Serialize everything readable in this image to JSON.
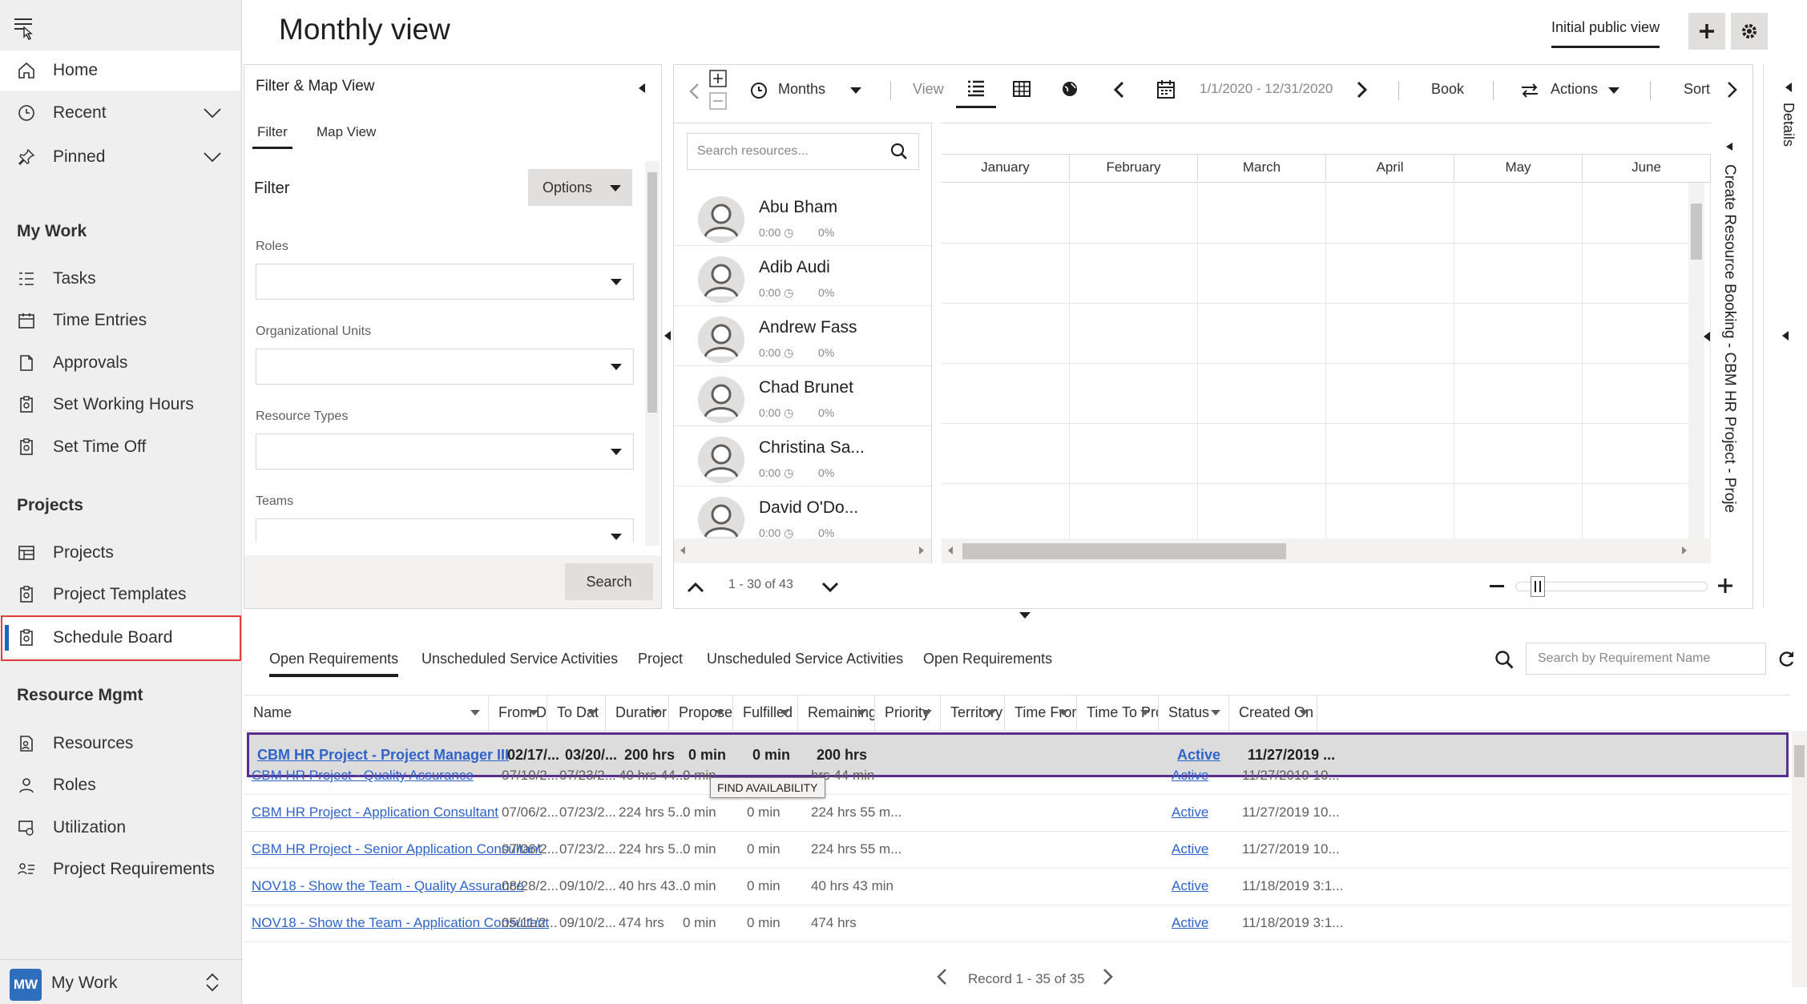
{
  "sidebar": {
    "menu_icon": "hamburger-icon",
    "home": "Home",
    "recent": "Recent",
    "pinned": "Pinned",
    "sections": [
      {
        "title": "My Work",
        "items": [
          "Tasks",
          "Time Entries",
          "Approvals",
          "Set Working Hours",
          "Set Time Off"
        ]
      },
      {
        "title": "Projects",
        "items": [
          "Projects",
          "Project Templates",
          "Schedule Board"
        ]
      },
      {
        "title": "Resource Mgmt",
        "items": [
          "Resources",
          "Roles",
          "Utilization",
          "Project Requirements"
        ]
      }
    ],
    "active_item": "Schedule Board",
    "area_badge": "MW",
    "area_label": "My Work"
  },
  "header": {
    "title": "Monthly view",
    "view_name": "Initial public view"
  },
  "filter_panel": {
    "title": "Filter & Map View",
    "tabs": [
      "Filter",
      "Map View"
    ],
    "section_title": "Filter",
    "options_label": "Options",
    "fields": [
      "Roles",
      "Organizational Units",
      "Resource Types",
      "Teams"
    ],
    "search_button": "Search"
  },
  "board": {
    "timescale": "Months",
    "view_label": "View",
    "date_range": "1/1/2020 - 12/31/2020",
    "book_label": "Book",
    "actions_label": "Actions",
    "sort_label": "Sort",
    "search_placeholder": "Search resources...",
    "months": [
      "January",
      "February",
      "March",
      "April",
      "May",
      "June"
    ],
    "resources": [
      {
        "name": "Abu Bham",
        "hours": "0:00",
        "pct": "0%"
      },
      {
        "name": "Adib Audi",
        "hours": "0:00",
        "pct": "0%"
      },
      {
        "name": "Andrew Fass",
        "hours": "0:00",
        "pct": "0%"
      },
      {
        "name": "Chad Brunet",
        "hours": "0:00",
        "pct": "0%"
      },
      {
        "name": "Christina Sa...",
        "hours": "0:00",
        "pct": "0%"
      },
      {
        "name": "David O'Do...",
        "hours": "0:00",
        "pct": "0%"
      }
    ],
    "paging": "1 - 30 of 43",
    "zoom_fraction": 0.08
  },
  "details_rail": {
    "label": "Details",
    "booking_label": "Create Resource Booking - CBM HR Project - Proje"
  },
  "requirements": {
    "tabs": [
      "Open Requirements",
      "Unscheduled Service Activities",
      "Project",
      "Unscheduled Service Activities",
      "Open Requirements"
    ],
    "search_placeholder": "Search by Requirement Name",
    "columns": [
      "Name",
      "From D",
      "To Dat",
      "Duratior",
      "Propose",
      "Fulfilled",
      "Remaining",
      "Priority",
      "Territory",
      "Time From",
      "Time To Pro",
      "Status",
      "Created On"
    ],
    "rows": [
      {
        "name": "CBM HR Project - Project Manager III",
        "from": "02/17/...",
        "to": "03/20/...",
        "duration": "200 hrs",
        "proposed": "0 min",
        "fulfilled": "0 min",
        "remaining": "200 hrs",
        "status": "Active",
        "created": "11/27/2019 ..."
      },
      {
        "name": "CBM HR Project - Quality Assurance",
        "from": "07/10/2...",
        "to": "07/23/2...",
        "duration": "40 hrs 44...",
        "proposed": "0 min",
        "fulfilled": "",
        "remaining": "hrs 44 min",
        "status": "Active",
        "created": "11/27/2019 10..."
      },
      {
        "name": "CBM HR Project - Application Consultant",
        "from": "07/06/2...",
        "to": "07/23/2...",
        "duration": "224 hrs 5...",
        "proposed": "0 min",
        "fulfilled": "0 min",
        "remaining": "224 hrs 55 m...",
        "status": "Active",
        "created": "11/27/2019 10..."
      },
      {
        "name": "CBM HR Project - Senior Application Consultant",
        "from": "07/06/2...",
        "to": "07/23/2...",
        "duration": "224 hrs 5...",
        "proposed": "0 min",
        "fulfilled": "0 min",
        "remaining": "224 hrs 55 m...",
        "status": "Active",
        "created": "11/27/2019 10..."
      },
      {
        "name": "NOV18 - Show the Team - Quality Assurance",
        "from": "08/28/2...",
        "to": "09/10/2...",
        "duration": "40 hrs 43...",
        "proposed": "0 min",
        "fulfilled": "0 min",
        "remaining": "40 hrs 43 min",
        "status": "Active",
        "created": "11/18/2019 3:1..."
      },
      {
        "name": "NOV18 - Show the Team - Application Consultant",
        "from": "05/11/2...",
        "to": "09/10/2...",
        "duration": "474 hrs",
        "proposed": "0 min",
        "fulfilled": "0 min",
        "remaining": "474 hrs",
        "status": "Active",
        "created": "11/18/2019 3:1..."
      }
    ],
    "tooltip": "FIND AVAILABILITY",
    "record_info": "Record 1 - 35 of 35"
  },
  "colors": {
    "accent": "#1a64c5",
    "link": "#2e63cb",
    "selected_border": "#5c2d91",
    "highlight_box": "#e23d3d"
  }
}
